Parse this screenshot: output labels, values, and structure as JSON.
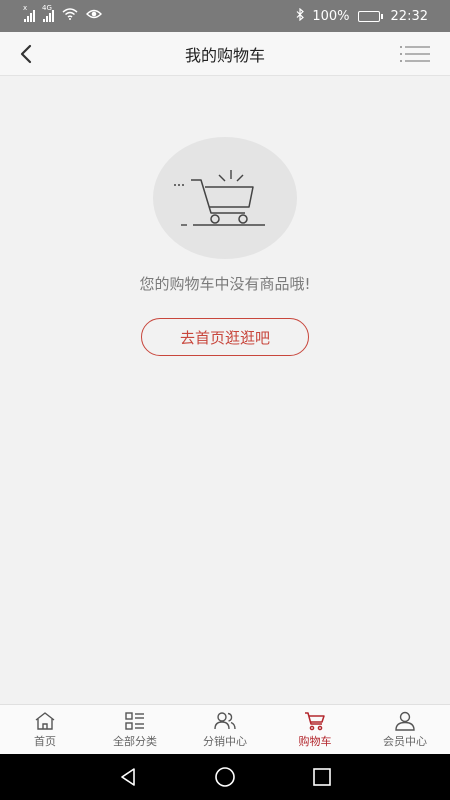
{
  "status_bar": {
    "battery_percent": "100%",
    "time": "22:32",
    "network_tag_1": "x",
    "network_tag_2": "4G"
  },
  "header": {
    "title": "我的购物车"
  },
  "empty_state": {
    "message": "您的购物车中没有商品哦!",
    "button_label": "去首页逛逛吧"
  },
  "tabbar": {
    "items": [
      {
        "label": "首页",
        "icon": "home-icon",
        "active": false
      },
      {
        "label": "全部分类",
        "icon": "category-icon",
        "active": false
      },
      {
        "label": "分销中心",
        "icon": "users-icon",
        "active": false
      },
      {
        "label": "购物车",
        "icon": "cart-icon",
        "active": true
      },
      {
        "label": "会员中心",
        "icon": "user-icon",
        "active": false
      }
    ]
  },
  "colors": {
    "accent": "#b3272d",
    "button_border": "#c8463c",
    "status_bar_bg": "#7a7a7a",
    "page_bg": "#f2f2f2"
  }
}
